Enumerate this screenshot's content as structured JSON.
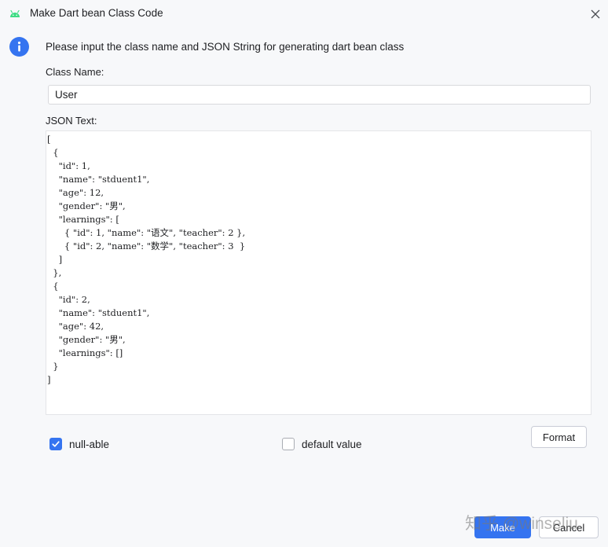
{
  "window": {
    "title": "Make Dart bean Class Code",
    "app_icon": "android-icon",
    "close_icon": "close-icon"
  },
  "message": {
    "icon": "info-icon",
    "text": "Please input the class name and JSON String for generating dart bean class"
  },
  "form": {
    "class_name_label": "Class Name:",
    "class_name_value": "User",
    "json_label": "JSON Text:",
    "json_text": "[\n  {\n    \"id\": 1,\n    \"name\": \"stduent1\",\n    \"age\": 12,\n    \"gender\": \"男\",\n    \"learnings\": [\n      { \"id\": 1, \"name\": \"语文\", \"teacher\": 2 },\n      { \"id\": 2, \"name\": \"数学\", \"teacher\": 3  }\n    ]\n  },\n  {\n    \"id\": 2,\n    \"name\": \"stduent1\",\n    \"age\": 42,\n    \"gender\": \"男\",\n    \"learnings\": []\n  }\n]"
  },
  "options": {
    "null_able": {
      "label": "null-able",
      "checked": true
    },
    "default_value": {
      "label": "default value",
      "checked": false
    }
  },
  "buttons": {
    "format": "Format",
    "make": "Make",
    "cancel": "Cancel"
  },
  "watermark": "知乎 @winseliu",
  "colors": {
    "accent": "#3574f0",
    "android_green": "#3ddc84",
    "background": "#f7f8fa"
  }
}
